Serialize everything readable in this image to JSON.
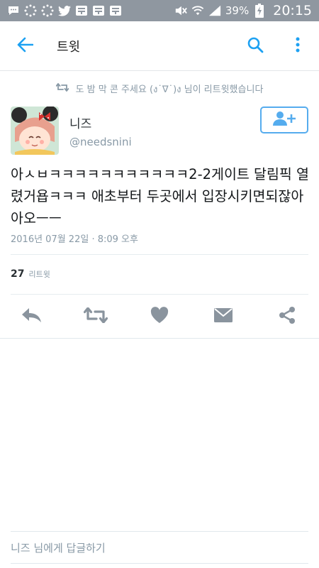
{
  "status_bar": {
    "battery_percent": "39%",
    "time": "20:15",
    "icons": [
      "chat-bubble-icon",
      "spinner-icon",
      "spinner-icon",
      "twitter-bird-icon",
      "app-badge-icon",
      "app-badge-icon",
      "app-badge-icon",
      "mute-icon",
      "wifi-icon",
      "signal-icon",
      "battery-icon"
    ]
  },
  "header": {
    "title": "트윗",
    "back_icon": "arrow-left-icon",
    "search_icon": "search-icon",
    "overflow_icon": "more-vert-icon"
  },
  "tweet": {
    "retweet_context": "도 밤 막 콘 주세요 (ง˙∇˙)ง 님이 리트윗했습니다",
    "author": {
      "display_name": "니즈",
      "handle": "@needsnini"
    },
    "text": "아ㅅㅂㅋㅋㅋㅋㅋㅋㅋㅋㅋㅋㅋ2-2게이트 달림픽 열렸거욥ㅋㅋㅋ 애초부터 두곳에서 입장시키면되잖아 아오ㅡㅡ",
    "timestamp": "2016년 07월 22일 · 8:09 오후",
    "retweet_count": "27",
    "retweet_label": "리트윗"
  },
  "reply": {
    "placeholder": "니즈 님에게 답글하기"
  },
  "colors": {
    "accent": "#1da1f2",
    "status_bar": "#8f97a0",
    "muted_text": "#8899a6",
    "action_icons": "#8a949e"
  }
}
